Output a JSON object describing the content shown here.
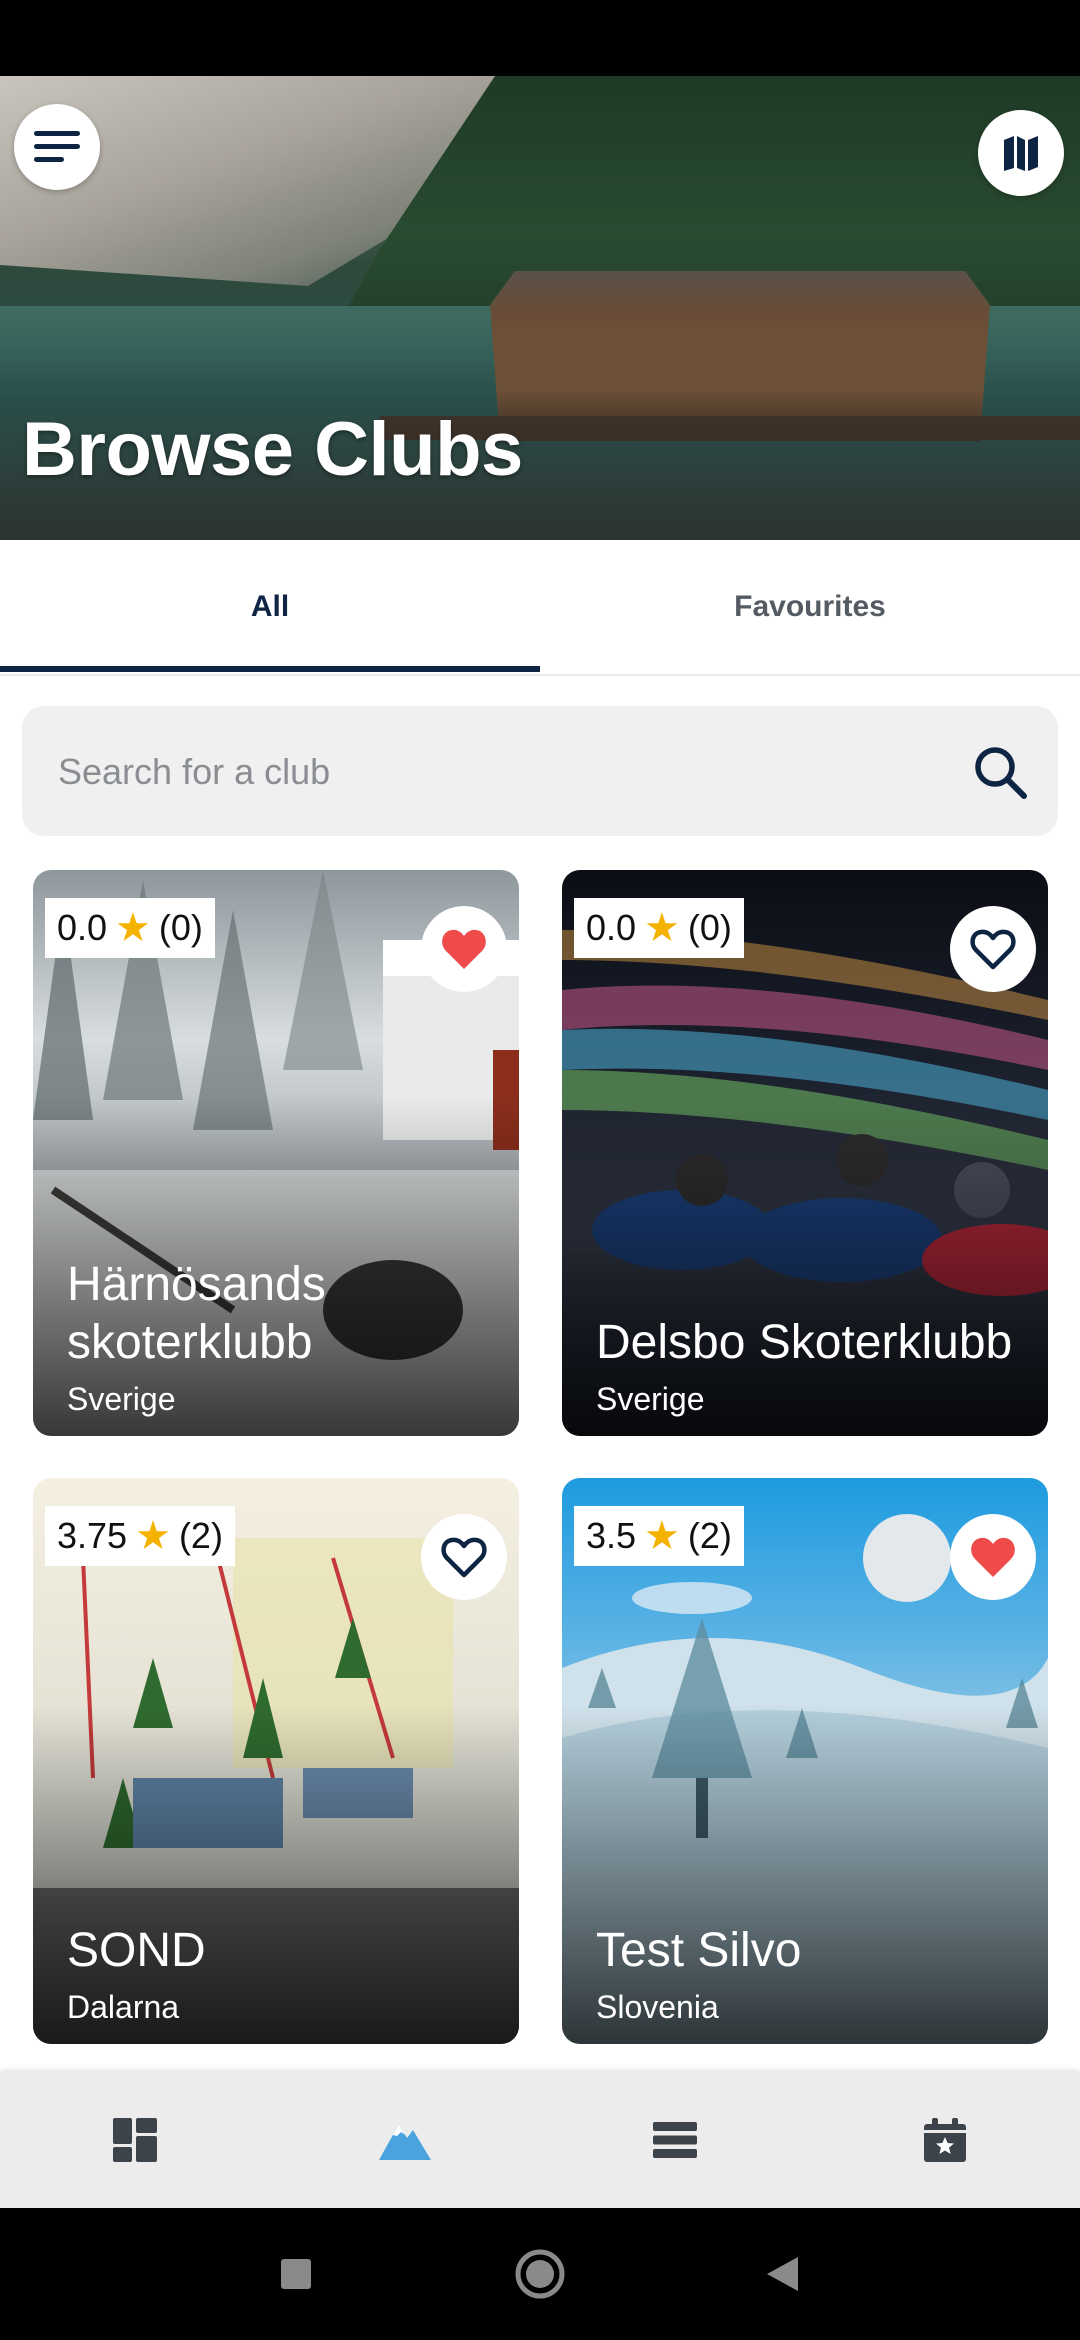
{
  "header": {
    "title": "Browse Clubs",
    "menu_icon": "menu-icon",
    "map_icon": "map-icon"
  },
  "tabs": [
    {
      "label": "All",
      "active": true
    },
    {
      "label": "Favourites",
      "active": false
    }
  ],
  "search": {
    "placeholder": "Search for a club",
    "value": "",
    "icon": "search-icon"
  },
  "clubs": [
    {
      "rating": "0.0",
      "count": "(0)",
      "name": "Härnösands skoterklubb",
      "region": "Sverige",
      "favourite": true
    },
    {
      "rating": "0.0",
      "count": "(0)",
      "name": "Delsbo Skoterklubb",
      "region": "Sverige",
      "favourite": false
    },
    {
      "rating": "3.75",
      "count": "(2)",
      "name": "SOND",
      "region": "Dalarna",
      "favourite": false
    },
    {
      "rating": "3.5",
      "count": "(2)",
      "name": "Test Silvo",
      "region": "Slovenia",
      "favourite": true
    }
  ],
  "bottom_nav": [
    {
      "icon": "dashboard-icon",
      "active": false
    },
    {
      "icon": "mountain-icon",
      "active": true
    },
    {
      "icon": "list-icon",
      "active": false
    },
    {
      "icon": "calendar-star-icon",
      "active": false
    }
  ],
  "colors": {
    "primary": "#0e2443",
    "accent": "#4aa3df",
    "heart": "#ef4b4b",
    "star": "#f5b300"
  }
}
